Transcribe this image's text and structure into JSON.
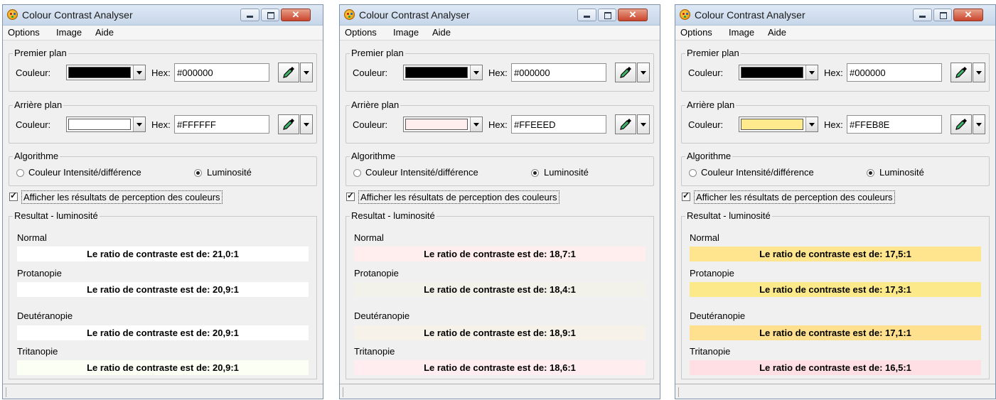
{
  "windows": [
    {
      "title": "Colour Contrast Analyser",
      "menu": [
        "Options",
        "Image",
        "Aide"
      ],
      "foreground": {
        "legend": "Premier plan",
        "color_label": "Couleur:",
        "hex_label": "Hex:",
        "hex_value": "#000000",
        "swatch": "#000000"
      },
      "background": {
        "legend": "Arrière plan",
        "color_label": "Couleur:",
        "hex_label": "Hex:",
        "hex_value": "#FFFFFF",
        "swatch": "#FFFFFF"
      },
      "algorithm": {
        "legend": "Algorithme",
        "option1": "Couleur Intensité/différence",
        "option2": "Luminosité",
        "selected": "Luminosité"
      },
      "checkbox_label": "Afficher les résultats de perception des couleurs",
      "results": {
        "legend": "Resultat - luminosité",
        "rows": [
          {
            "label": "Normal",
            "text": "Le ratio de contraste est de: 21,0:1",
            "color": "#FFFFFF"
          },
          {
            "label": "Protanopie",
            "text": "Le ratio de contraste est de: 20,9:1",
            "color": "#FFFFFF"
          },
          {
            "label": "Deutéranopie",
            "text": "Le ratio de contraste est de: 20,9:1",
            "color": "#FFFFFF"
          },
          {
            "label": "Tritanopie",
            "text": "Le ratio de contraste est de: 20,9:1",
            "color": "#FCFFF4"
          }
        ]
      }
    },
    {
      "title": "Colour Contrast Analyser",
      "menu": [
        "Options",
        "Image",
        "Aide"
      ],
      "foreground": {
        "legend": "Premier plan",
        "color_label": "Couleur:",
        "hex_label": "Hex:",
        "hex_value": "#000000",
        "swatch": "#000000"
      },
      "background": {
        "legend": "Arrière plan",
        "color_label": "Couleur:",
        "hex_label": "Hex:",
        "hex_value": "#FFEEED",
        "swatch": "#FFEEED"
      },
      "algorithm": {
        "legend": "Algorithme",
        "option1": "Couleur Intensité/différence",
        "option2": "Luminosité",
        "selected": "Luminosité"
      },
      "checkbox_label": "Afficher les résultats de perception des couleurs",
      "results": {
        "legend": "Resultat - luminosité",
        "rows": [
          {
            "label": "Normal",
            "text": "Le ratio de contraste est de: 18,7:1",
            "color": "#FFEEED"
          },
          {
            "label": "Protanopie",
            "text": "Le ratio de contraste est de: 18,4:1",
            "color": "#F2F1EA"
          },
          {
            "label": "Deutéranopie",
            "text": "Le ratio de contraste est de: 18,9:1",
            "color": "#F6F2EA"
          },
          {
            "label": "Tritanopie",
            "text": "Le ratio de contraste est de: 18,6:1",
            "color": "#FFEDEF"
          }
        ]
      }
    },
    {
      "title": "Colour Contrast Analyser",
      "menu": [
        "Options",
        "Image",
        "Aide"
      ],
      "foreground": {
        "legend": "Premier plan",
        "color_label": "Couleur:",
        "hex_label": "Hex:",
        "hex_value": "#000000",
        "swatch": "#000000"
      },
      "background": {
        "legend": "Arrière plan",
        "color_label": "Couleur:",
        "hex_label": "Hex:",
        "hex_value": "#FFEB8E",
        "swatch": "#FFEB8E"
      },
      "algorithm": {
        "legend": "Algorithme",
        "option1": "Couleur Intensité/différence",
        "option2": "Luminosité",
        "selected": "Luminosité"
      },
      "checkbox_label": "Afficher les résultats de perception des couleurs",
      "results": {
        "legend": "Resultat - luminosité",
        "rows": [
          {
            "label": "Normal",
            "text": "Le ratio de contraste est de: 17,5:1",
            "color": "#FFE68E"
          },
          {
            "label": "Protanopie",
            "text": "Le ratio de contraste est de: 17,3:1",
            "color": "#FCE98A"
          },
          {
            "label": "Deutéranopie",
            "text": "Le ratio de contraste est de: 17,1:1",
            "color": "#FFE08E"
          },
          {
            "label": "Tritanopie",
            "text": "Le ratio de contraste est de: 16,5:1",
            "color": "#FFDFE3"
          }
        ]
      }
    }
  ]
}
